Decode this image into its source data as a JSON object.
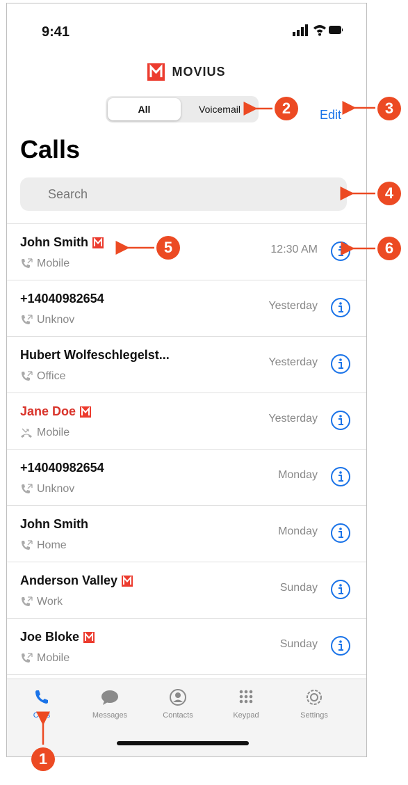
{
  "status": {
    "time": "9:41"
  },
  "brand": {
    "name": "MOVIUS",
    "color": "#ec3c2f"
  },
  "segment": {
    "all_label": "All",
    "voicemail_label": "Voicemail",
    "selected": "All"
  },
  "header": {
    "edit_label": "Edit",
    "title": "Calls"
  },
  "search": {
    "placeholder": "Search",
    "value": ""
  },
  "calls": [
    {
      "name": "John Smith",
      "movius": true,
      "missed": false,
      "type": "Mobile",
      "time": "12:30 AM"
    },
    {
      "name": "+14040982654",
      "movius": false,
      "missed": false,
      "type": "Unknov",
      "time": "Yesterday"
    },
    {
      "name": "Hubert Wolfeschlegelst...",
      "movius": false,
      "missed": false,
      "type": "Office",
      "time": "Yesterday"
    },
    {
      "name": "Jane Doe",
      "movius": true,
      "missed": true,
      "type": "Mobile",
      "time": "Yesterday"
    },
    {
      "name": "+14040982654",
      "movius": false,
      "missed": false,
      "type": "Unknov",
      "time": "Monday"
    },
    {
      "name": "John Smith",
      "movius": false,
      "missed": false,
      "type": "Home",
      "time": "Monday"
    },
    {
      "name": "Anderson Valley",
      "movius": true,
      "missed": false,
      "type": "Work",
      "time": "Sunday"
    },
    {
      "name": "Joe Bloke",
      "movius": true,
      "missed": false,
      "type": "Mobile",
      "time": "Sunday"
    }
  ],
  "tabs": [
    {
      "label": "Calls",
      "icon": "phone-icon",
      "active": true
    },
    {
      "label": "Messages",
      "icon": "chat-bubble-icon",
      "active": false
    },
    {
      "label": "Contacts",
      "icon": "person-circle-icon",
      "active": false
    },
    {
      "label": "Keypad",
      "icon": "keypad-icon",
      "active": false
    },
    {
      "label": "Settings",
      "icon": "gear-icon",
      "active": false
    }
  ],
  "callouts": [
    "1",
    "2",
    "3",
    "4",
    "5",
    "6"
  ],
  "colors": {
    "accent": "#1a73e8",
    "missed": "#d9342b",
    "callout": "#ec4a23"
  }
}
